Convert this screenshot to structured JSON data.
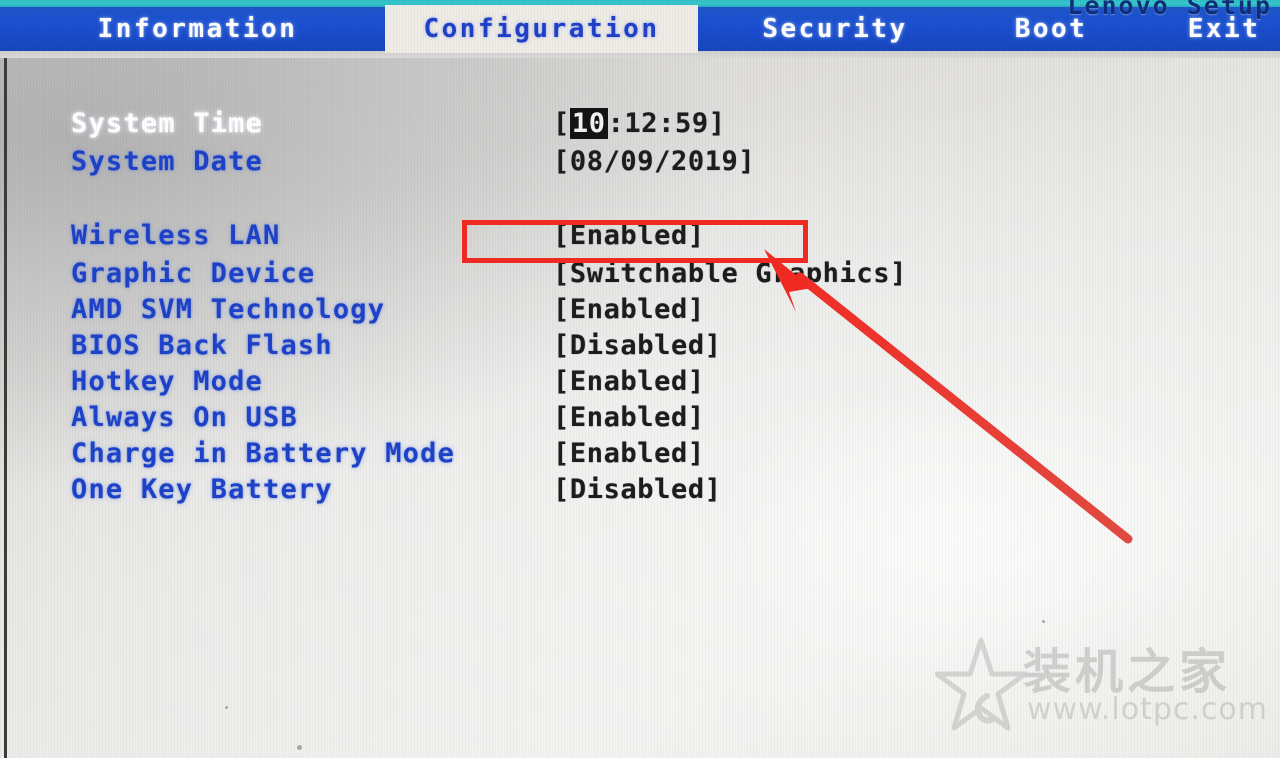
{
  "window": {
    "title": "Lenovo Setup"
  },
  "menu": {
    "tabs": [
      {
        "label": "Information",
        "active": false
      },
      {
        "label": "Configuration",
        "active": true
      },
      {
        "label": "Security",
        "active": false
      },
      {
        "label": "Boot",
        "active": false
      },
      {
        "label": "Exit",
        "active": false
      }
    ]
  },
  "settings": {
    "rows": [
      {
        "label": "System Time",
        "value_prefix": "[",
        "value_highlight": "10",
        "value_suffix": ":12:59]",
        "selected": true
      },
      {
        "label": "System Date",
        "value": "[08/09/2019]",
        "selected": false
      },
      {
        "label": "Wireless LAN",
        "value": "[Enabled]",
        "selected": false,
        "annotated": true
      },
      {
        "label": "Graphic Device",
        "value": "[Switchable Graphics]",
        "selected": false
      },
      {
        "label": "AMD SVM Technology",
        "value": "[Enabled]",
        "selected": false
      },
      {
        "label": "BIOS Back Flash",
        "value": "[Disabled]",
        "selected": false
      },
      {
        "label": "Hotkey Mode",
        "value": "[Enabled]",
        "selected": false
      },
      {
        "label": "Always On USB",
        "value": "[Enabled]",
        "selected": false
      },
      {
        "label": "Charge in Battery Mode",
        "value": "[Enabled]",
        "selected": false
      },
      {
        "label": "One Key Battery",
        "value": "[Disabled]",
        "selected": false
      }
    ]
  },
  "annotation": {
    "color": "#ee2a23",
    "target_label": "Wireless LAN",
    "target_value": "[Enabled]"
  },
  "watermark": {
    "brand": "装机之家",
    "url": "www.lotpc.com",
    "icon": "star-logo"
  },
  "colors": {
    "menu_blue": "#1b4fd2",
    "top_strip_cyan": "#32c4c8",
    "active_tab_bg": "#efece6",
    "active_tab_text": "#2140c8",
    "label_blue": "#1e42c8",
    "value_black": "#1d1d1d",
    "screen_bg": "#e9e9e6",
    "annotation_red": "#ee2a23"
  }
}
